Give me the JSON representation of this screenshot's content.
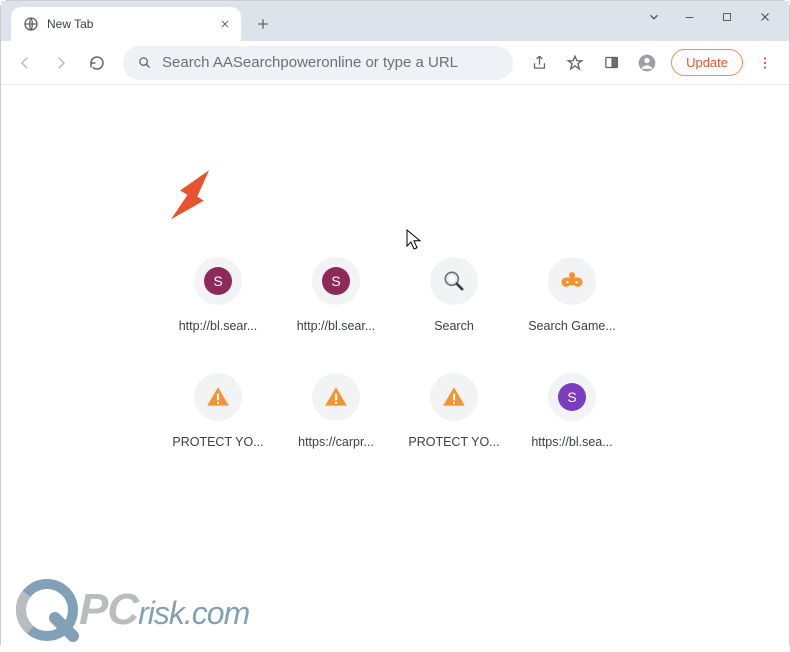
{
  "window": {
    "tab_title": "New Tab"
  },
  "toolbar": {
    "omnibox_placeholder": "Search AASearchpoweronline or type a URL",
    "update_label": "Update"
  },
  "shortcuts": [
    {
      "label": "http://bl.sear...",
      "icon": "letter",
      "letter": "S",
      "bg": "#8e2a5a"
    },
    {
      "label": "http://bl.sear...",
      "icon": "letter",
      "letter": "S",
      "bg": "#8e2a5a"
    },
    {
      "label": "Search",
      "icon": "magnifier"
    },
    {
      "label": "Search Game...",
      "icon": "gamepad"
    },
    {
      "label": "PROTECT YO...",
      "icon": "warning"
    },
    {
      "label": "https://carpr...",
      "icon": "warning"
    },
    {
      "label": "PROTECT YO...",
      "icon": "warning"
    },
    {
      "label": "https://bl.sea...",
      "icon": "letter",
      "letter": "S",
      "bg": "#7b3dbf"
    }
  ],
  "watermark": {
    "prefix": "PC",
    "suffix": "risk.com"
  },
  "colors": {
    "accent_orange": "#e8532f",
    "warning_orange": "#f59331",
    "purple1": "#8e2a5a",
    "purple2": "#7b3dbf",
    "game_orange": "#f59331",
    "wm_blue": "#2a5d87",
    "wm_gray": "#8a8f93"
  }
}
